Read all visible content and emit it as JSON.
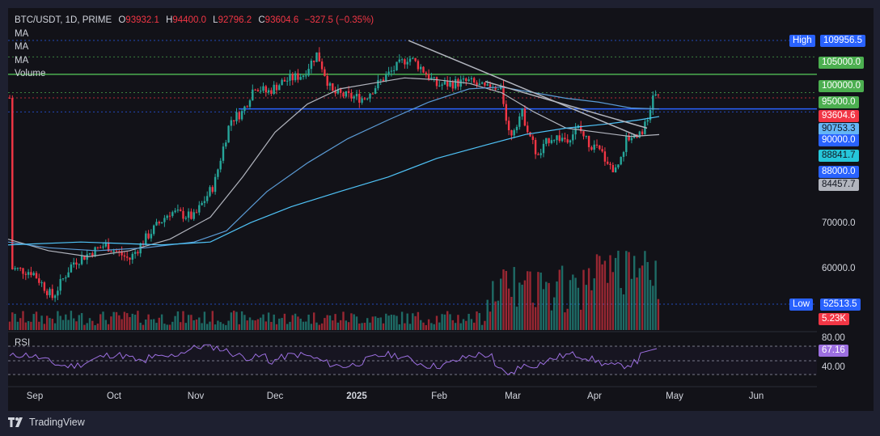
{
  "header": {
    "symbol": "BTC/USDT, 1D, PRIME",
    "open_key": "O",
    "open": "93932.1",
    "high_key": "H",
    "high": "94400.0",
    "low_key": "L",
    "low": "92796.2",
    "close_key": "C",
    "close": "93604.6",
    "change": "−327.5 (−0.35%)"
  },
  "indicators": [
    "MA",
    "MA",
    "MA",
    "Volume"
  ],
  "rsi_label": "RSI",
  "price_scale": {
    "high_label": "High",
    "high_value": "109956.5",
    "low_label": "Low",
    "low_value": "52513.5",
    "ticks": [
      "70000.0",
      "60000.0"
    ],
    "tags": [
      {
        "text": "105000.0",
        "bg": "#4caf50",
        "fg": "#ffffff"
      },
      {
        "text": "100000.0",
        "bg": "#4caf50",
        "fg": "#ffffff"
      },
      {
        "text": "95000.0",
        "bg": "#4caf50",
        "fg": "#ffffff"
      },
      {
        "text": "93604.6",
        "bg": "#f23645",
        "fg": "#ffffff"
      },
      {
        "text": "90753.3",
        "bg": "#64b5f6",
        "fg": "#131722"
      },
      {
        "text": "90000.0",
        "bg": "#2962ff",
        "fg": "#ffffff"
      },
      {
        "text": "88841.7",
        "bg": "#26c6da",
        "fg": "#131722"
      },
      {
        "text": "88000.0",
        "bg": "#2962ff",
        "fg": "#ffffff"
      },
      {
        "text": "84457.7",
        "bg": "#b2b5be",
        "fg": "#131722"
      },
      {
        "text": "5.23K",
        "bg": "#f23645",
        "fg": "#ffffff"
      }
    ],
    "rsi_ticks": [
      "80.00",
      "40.00"
    ],
    "rsi_value": "67.16",
    "rsi_color": "#9c6fe0"
  },
  "time_axis": [
    "Sep",
    "Oct",
    "Nov",
    "Dec",
    "2025",
    "Feb",
    "Mar",
    "Apr",
    "May",
    "Jun"
  ],
  "brand": "TradingView",
  "colors": {
    "up": "#26a69a",
    "down": "#f23645",
    "ma_short": "#b2b5be",
    "ma_mid": "#5b9bd5",
    "ma_long": "#4fc3f7"
  },
  "chart_data": {
    "type": "candlestick",
    "scale": "log",
    "ylim": [
      50000,
      115000
    ],
    "horizontal_levels": [
      105000,
      100000,
      95000,
      90000,
      88000
    ],
    "last_price": 93604.6,
    "ma_values_last": {
      "ma1": 84457.7,
      "ma2": 90753.3,
      "ma3": 88841.7
    },
    "rsi_last": 67.16,
    "rsi_levels": [
      70,
      30
    ],
    "period": "Aug 2024 – Apr 2025"
  }
}
